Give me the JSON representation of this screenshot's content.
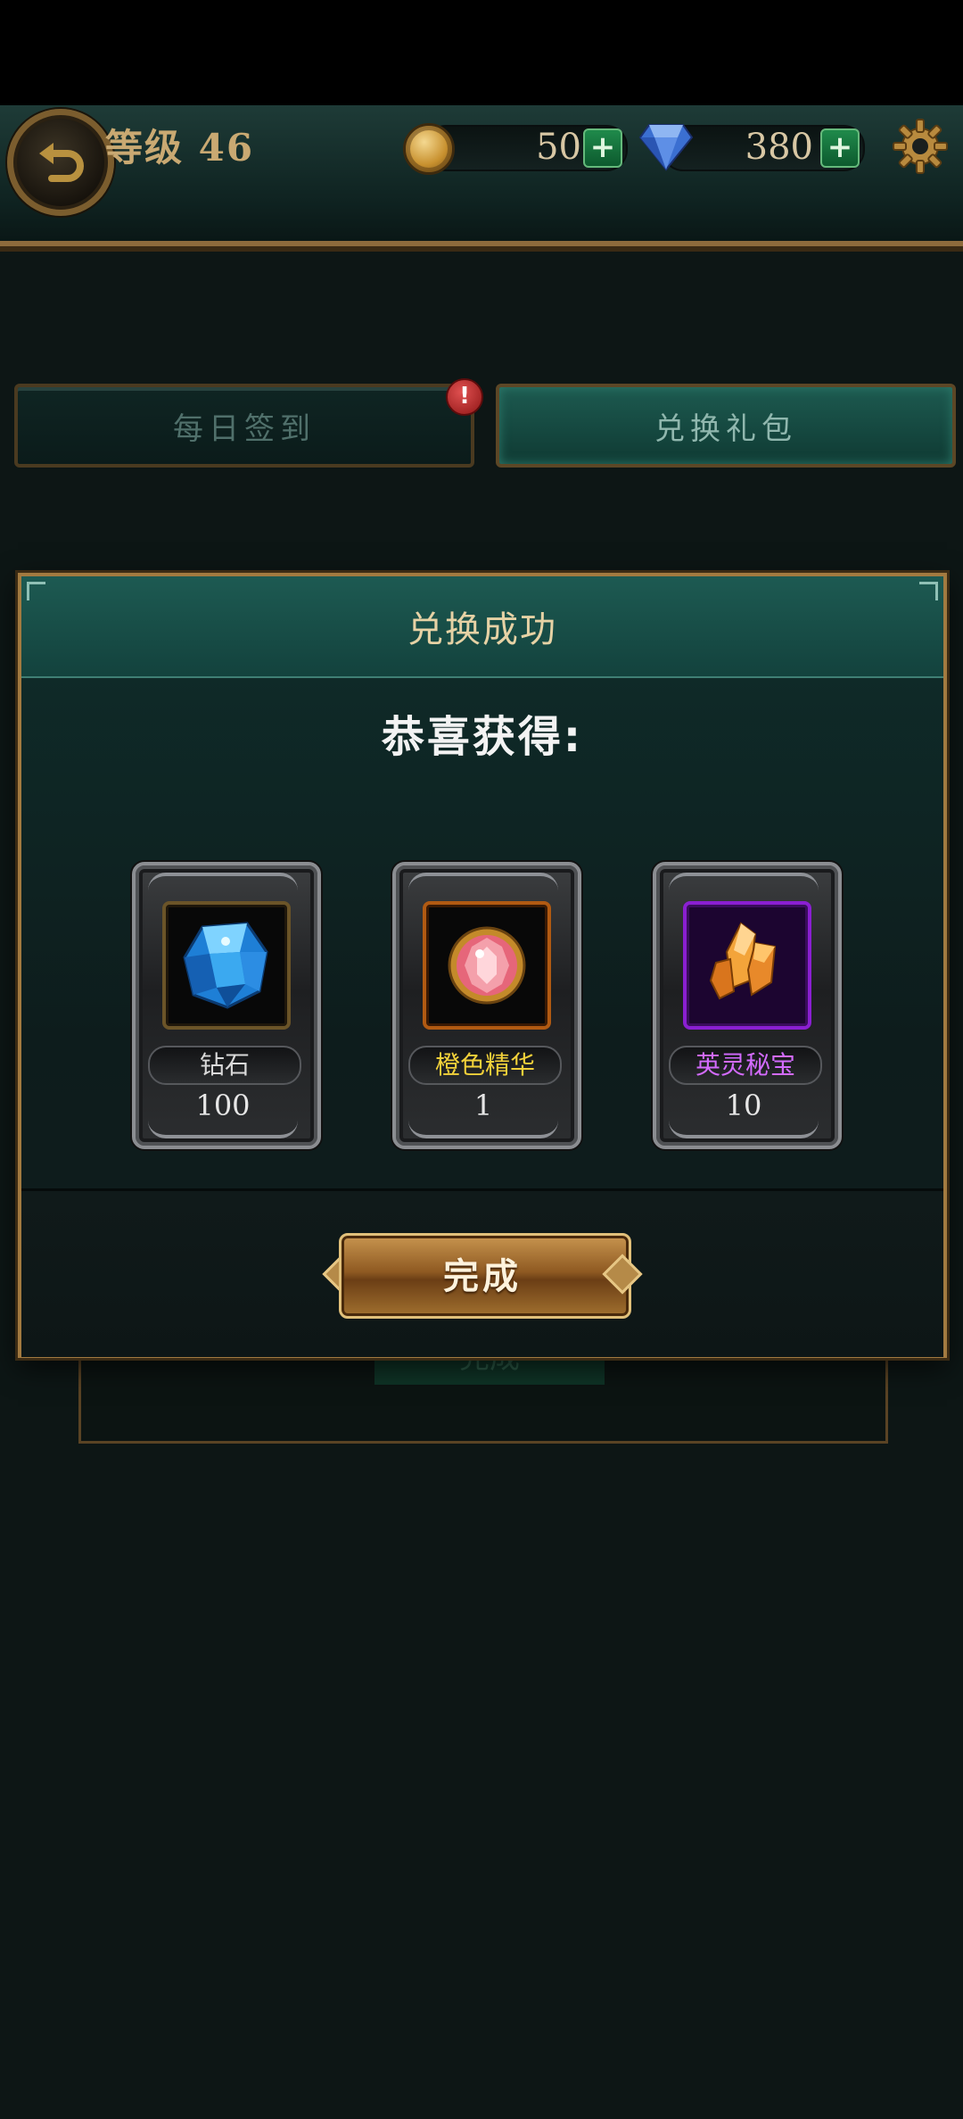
{
  "header": {
    "level_label": "等级 46",
    "gold_value": "50",
    "diamond_value": "380",
    "plus_label": "+"
  },
  "tabs": [
    {
      "label": "每日签到",
      "badge": "!"
    },
    {
      "label": "兑换礼包"
    }
  ],
  "modal": {
    "title": "兑换成功",
    "congrats": "恭喜获得:",
    "rewards": [
      {
        "name": "钻石",
        "count": "100",
        "name_color": "#d9d9d9",
        "frame_color": "#3b2f1a",
        "icon": "blue-diamond-icon"
      },
      {
        "name": "橙色精华",
        "count": "1",
        "name_color": "#f2d13a",
        "frame_color": "#b15a12",
        "icon": "orange-essence-icon"
      },
      {
        "name": "英灵秘宝",
        "count": "10",
        "name_color": "#d36bff",
        "frame_color": "#8a1fd1",
        "icon": "spirit-treasure-icon"
      }
    ],
    "done_label": "完成"
  },
  "background": {
    "complete_label": "完成"
  }
}
